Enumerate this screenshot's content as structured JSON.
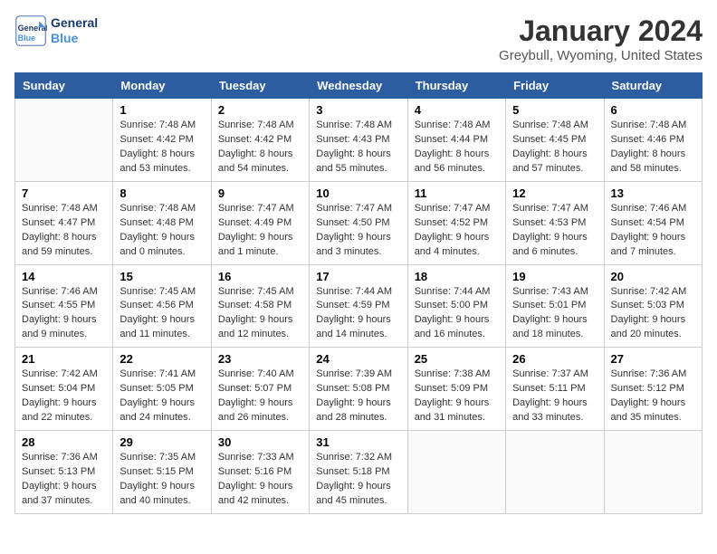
{
  "header": {
    "logo_line1": "General",
    "logo_line2": "Blue",
    "title": "January 2024",
    "subtitle": "Greybull, Wyoming, United States"
  },
  "calendar": {
    "days_of_week": [
      "Sunday",
      "Monday",
      "Tuesday",
      "Wednesday",
      "Thursday",
      "Friday",
      "Saturday"
    ],
    "weeks": [
      [
        {
          "day": "",
          "info": ""
        },
        {
          "day": "1",
          "info": "Sunrise: 7:48 AM\nSunset: 4:42 PM\nDaylight: 8 hours\nand 53 minutes."
        },
        {
          "day": "2",
          "info": "Sunrise: 7:48 AM\nSunset: 4:42 PM\nDaylight: 8 hours\nand 54 minutes."
        },
        {
          "day": "3",
          "info": "Sunrise: 7:48 AM\nSunset: 4:43 PM\nDaylight: 8 hours\nand 55 minutes."
        },
        {
          "day": "4",
          "info": "Sunrise: 7:48 AM\nSunset: 4:44 PM\nDaylight: 8 hours\nand 56 minutes."
        },
        {
          "day": "5",
          "info": "Sunrise: 7:48 AM\nSunset: 4:45 PM\nDaylight: 8 hours\nand 57 minutes."
        },
        {
          "day": "6",
          "info": "Sunrise: 7:48 AM\nSunset: 4:46 PM\nDaylight: 8 hours\nand 58 minutes."
        }
      ],
      [
        {
          "day": "7",
          "info": "Sunrise: 7:48 AM\nSunset: 4:47 PM\nDaylight: 8 hours\nand 59 minutes."
        },
        {
          "day": "8",
          "info": "Sunrise: 7:48 AM\nSunset: 4:48 PM\nDaylight: 9 hours\nand 0 minutes."
        },
        {
          "day": "9",
          "info": "Sunrise: 7:47 AM\nSunset: 4:49 PM\nDaylight: 9 hours\nand 1 minute."
        },
        {
          "day": "10",
          "info": "Sunrise: 7:47 AM\nSunset: 4:50 PM\nDaylight: 9 hours\nand 3 minutes."
        },
        {
          "day": "11",
          "info": "Sunrise: 7:47 AM\nSunset: 4:52 PM\nDaylight: 9 hours\nand 4 minutes."
        },
        {
          "day": "12",
          "info": "Sunrise: 7:47 AM\nSunset: 4:53 PM\nDaylight: 9 hours\nand 6 minutes."
        },
        {
          "day": "13",
          "info": "Sunrise: 7:46 AM\nSunset: 4:54 PM\nDaylight: 9 hours\nand 7 minutes."
        }
      ],
      [
        {
          "day": "14",
          "info": "Sunrise: 7:46 AM\nSunset: 4:55 PM\nDaylight: 9 hours\nand 9 minutes."
        },
        {
          "day": "15",
          "info": "Sunrise: 7:45 AM\nSunset: 4:56 PM\nDaylight: 9 hours\nand 11 minutes."
        },
        {
          "day": "16",
          "info": "Sunrise: 7:45 AM\nSunset: 4:58 PM\nDaylight: 9 hours\nand 12 minutes."
        },
        {
          "day": "17",
          "info": "Sunrise: 7:44 AM\nSunset: 4:59 PM\nDaylight: 9 hours\nand 14 minutes."
        },
        {
          "day": "18",
          "info": "Sunrise: 7:44 AM\nSunset: 5:00 PM\nDaylight: 9 hours\nand 16 minutes."
        },
        {
          "day": "19",
          "info": "Sunrise: 7:43 AM\nSunset: 5:01 PM\nDaylight: 9 hours\nand 18 minutes."
        },
        {
          "day": "20",
          "info": "Sunrise: 7:42 AM\nSunset: 5:03 PM\nDaylight: 9 hours\nand 20 minutes."
        }
      ],
      [
        {
          "day": "21",
          "info": "Sunrise: 7:42 AM\nSunset: 5:04 PM\nDaylight: 9 hours\nand 22 minutes."
        },
        {
          "day": "22",
          "info": "Sunrise: 7:41 AM\nSunset: 5:05 PM\nDaylight: 9 hours\nand 24 minutes."
        },
        {
          "day": "23",
          "info": "Sunrise: 7:40 AM\nSunset: 5:07 PM\nDaylight: 9 hours\nand 26 minutes."
        },
        {
          "day": "24",
          "info": "Sunrise: 7:39 AM\nSunset: 5:08 PM\nDaylight: 9 hours\nand 28 minutes."
        },
        {
          "day": "25",
          "info": "Sunrise: 7:38 AM\nSunset: 5:09 PM\nDaylight: 9 hours\nand 31 minutes."
        },
        {
          "day": "26",
          "info": "Sunrise: 7:37 AM\nSunset: 5:11 PM\nDaylight: 9 hours\nand 33 minutes."
        },
        {
          "day": "27",
          "info": "Sunrise: 7:36 AM\nSunset: 5:12 PM\nDaylight: 9 hours\nand 35 minutes."
        }
      ],
      [
        {
          "day": "28",
          "info": "Sunrise: 7:36 AM\nSunset: 5:13 PM\nDaylight: 9 hours\nand 37 minutes."
        },
        {
          "day": "29",
          "info": "Sunrise: 7:35 AM\nSunset: 5:15 PM\nDaylight: 9 hours\nand 40 minutes."
        },
        {
          "day": "30",
          "info": "Sunrise: 7:33 AM\nSunset: 5:16 PM\nDaylight: 9 hours\nand 42 minutes."
        },
        {
          "day": "31",
          "info": "Sunrise: 7:32 AM\nSunset: 5:18 PM\nDaylight: 9 hours\nand 45 minutes."
        },
        {
          "day": "",
          "info": ""
        },
        {
          "day": "",
          "info": ""
        },
        {
          "day": "",
          "info": ""
        }
      ]
    ]
  }
}
